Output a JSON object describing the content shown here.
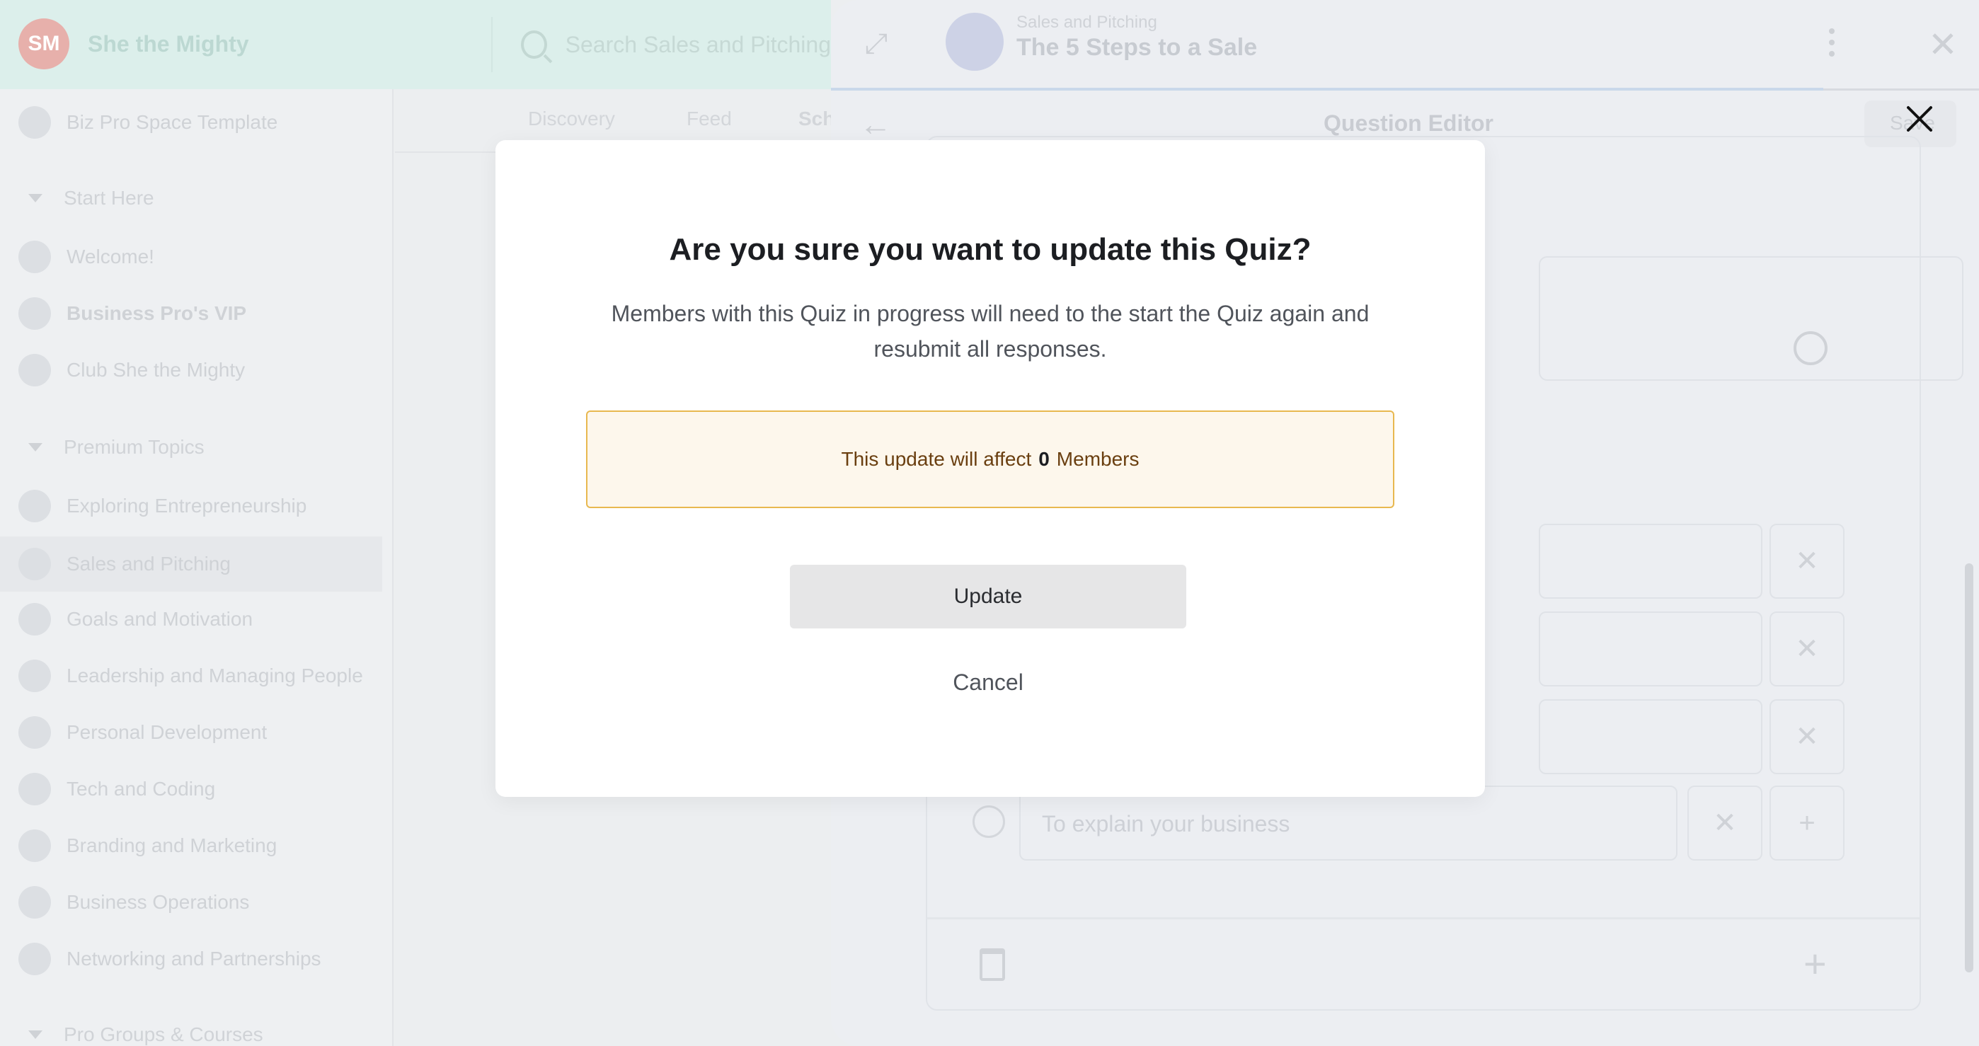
{
  "app": {
    "brand_logo": "SM",
    "brand_name": "She the Mighty",
    "search_placeholder": "Search Sales and Pitching"
  },
  "sidebar": {
    "template": "Biz Pro Space Template",
    "start_here": {
      "label": "Start Here",
      "items": [
        "Welcome!",
        "Business Pro's VIP",
        "Club She the Mighty"
      ]
    },
    "premium_topics": {
      "label": "Premium Topics",
      "items": [
        "Exploring Entrepreneurship",
        "Sales and Pitching",
        "Goals and Motivation",
        "Leadership and Managing People",
        "Personal Development",
        "Tech and Coding",
        "Branding and Marketing",
        "Business Operations",
        "Networking and Partnerships"
      ]
    },
    "pro_groups": {
      "label": "Pro Groups & Courses"
    }
  },
  "tabs": [
    "Discovery",
    "Feed",
    "Schedule"
  ],
  "drawer": {
    "subtitle": "Sales and Pitching",
    "title": "The 5 Steps to a Sale",
    "editor_title": "Question Editor",
    "save_label": "Save",
    "option_placeholder": "To explain your business"
  },
  "modal": {
    "title": "Are you sure you want to update this Quiz?",
    "description": "Members with this Quiz in progress will need to the start the Quiz again and resubmit all responses.",
    "warning_prefix": "This update will affect",
    "warning_count": "0",
    "warning_suffix": "Members",
    "update_label": "Update",
    "cancel_label": "Cancel"
  },
  "icons": {
    "close": "close-icon",
    "expand": "expand-icon",
    "back": "arrow-left-icon",
    "kebab": "more-vertical-icon",
    "emoji": "emoji-icon",
    "trash": "trash-icon",
    "add": "plus-icon"
  },
  "colors": {
    "warning_border": "#e8b84f",
    "warning_bg": "#fdf7ec",
    "warning_text": "#6a3f10",
    "update_button_bg": "#e6e6e7"
  }
}
